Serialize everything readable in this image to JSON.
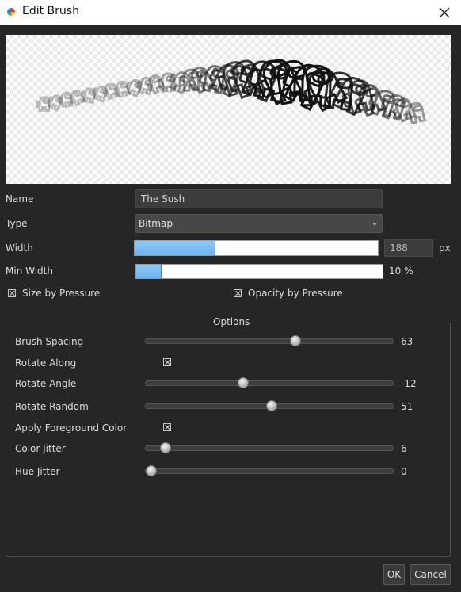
{
  "window": {
    "title": "Edit Brush",
    "icon": "palette-app-icon",
    "close_icon": "close-icon"
  },
  "fields": {
    "name_label": "Name",
    "name_value": "The Sush",
    "type_label": "Type",
    "type_value": "Bitmap",
    "width_label": "Width",
    "width_value": "188",
    "width_unit": "px",
    "width_fraction": 0.33,
    "min_width_label": "Min Width",
    "min_width_value": "10 %",
    "min_width_fraction": 0.1,
    "size_by_pressure": {
      "label": "Size by Pressure",
      "checked": true
    },
    "opacity_by_pressure": {
      "label": "Opacity by Pressure",
      "checked": true
    }
  },
  "options": {
    "title": "Options",
    "rows": [
      {
        "label": "Brush Spacing",
        "kind": "slider",
        "value": "63",
        "fraction": 0.61
      },
      {
        "label": "Rotate Along",
        "kind": "checkbox",
        "checked": true
      },
      {
        "label": "Rotate Angle",
        "kind": "slider",
        "value": "-12",
        "fraction": 0.39
      },
      {
        "label": "Rotate Random",
        "kind": "slider",
        "value": "51",
        "fraction": 0.51
      },
      {
        "label": "Apply Foreground Color",
        "kind": "checkbox",
        "checked": true
      },
      {
        "label": "Color Jitter",
        "kind": "slider",
        "value": "6",
        "fraction": 0.06
      },
      {
        "label": "Hue Jitter",
        "kind": "slider",
        "value": "0",
        "fraction": 0.0
      }
    ]
  },
  "buttons": {
    "ok": "OK",
    "cancel": "Cancel"
  },
  "colors": {
    "accent": "#7bbcf2",
    "background": "#262626",
    "titlebar": "#ffffff"
  }
}
